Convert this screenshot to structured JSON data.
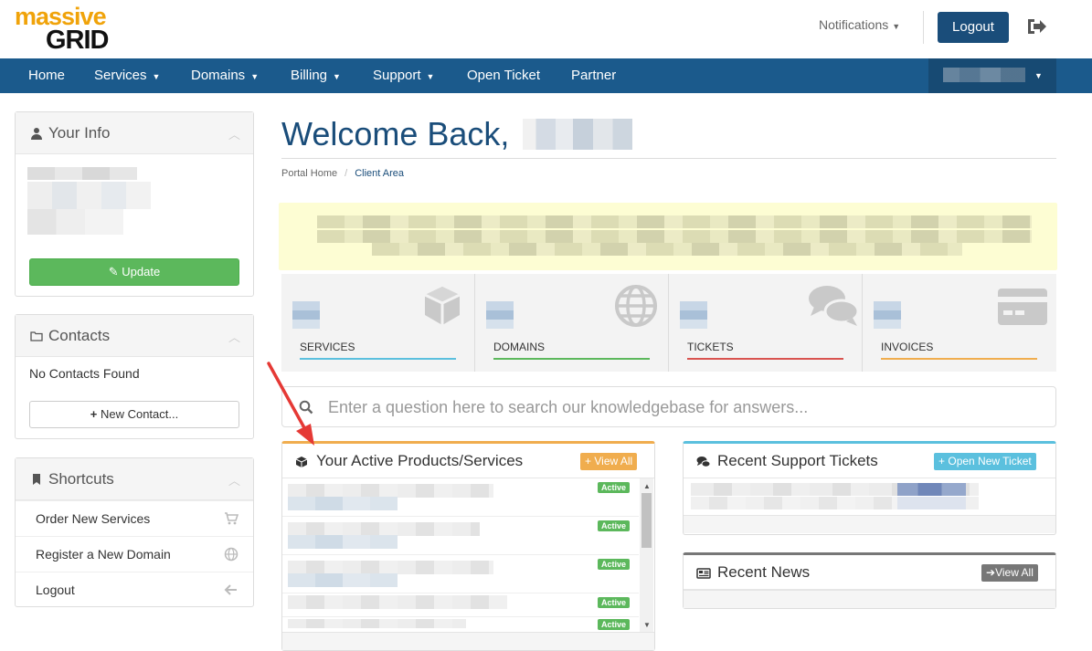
{
  "header": {
    "logo_line1": "massive",
    "logo_line2": "GRID",
    "notifications": "Notifications",
    "logout": "Logout"
  },
  "nav": {
    "items": [
      {
        "label": "Home"
      },
      {
        "label": "Services"
      },
      {
        "label": "Domains"
      },
      {
        "label": "Billing"
      },
      {
        "label": "Support"
      },
      {
        "label": "Open Ticket"
      },
      {
        "label": "Partner"
      }
    ]
  },
  "sidebar": {
    "your_info": {
      "title": "Your Info",
      "update_label": "Update"
    },
    "contacts": {
      "title": "Contacts",
      "empty_text": "No Contacts Found",
      "new_contact_label": "New Contact..."
    },
    "shortcuts": {
      "title": "Shortcuts",
      "items": [
        {
          "label": "Order New Services",
          "icon": "cart-icon"
        },
        {
          "label": "Register a New Domain",
          "icon": "globe-icon"
        },
        {
          "label": "Logout",
          "icon": "arrow-left-icon"
        }
      ]
    }
  },
  "main": {
    "welcome": "Welcome Back,",
    "breadcrumb": [
      "Portal Home",
      "Client Area"
    ],
    "tiles": [
      {
        "label": "SERVICES",
        "color": "#5bc0de",
        "icon": "cube-icon"
      },
      {
        "label": "DOMAINS",
        "color": "#5cb85c",
        "icon": "globe-icon"
      },
      {
        "label": "TICKETS",
        "color": "#d9534f",
        "icon": "comments-icon"
      },
      {
        "label": "INVOICES",
        "color": "#f0ad4e",
        "icon": "credit-card-icon"
      }
    ],
    "kb_placeholder": "Enter a question here to search our knowledgebase for answers...",
    "products": {
      "title": "Your Active Products/Services",
      "view_all": "View All",
      "accent": "#f0ad4e",
      "rows": [
        {
          "status": "Active"
        },
        {
          "status": "Active"
        },
        {
          "status": "Active"
        },
        {
          "status": "Active"
        },
        {
          "status": "Active"
        }
      ]
    },
    "tickets": {
      "title": "Recent Support Tickets",
      "open_new": "Open New Ticket",
      "accent": "#5bc0de"
    },
    "news": {
      "title": "Recent News",
      "view_all": "View All",
      "accent": "#777777"
    }
  }
}
